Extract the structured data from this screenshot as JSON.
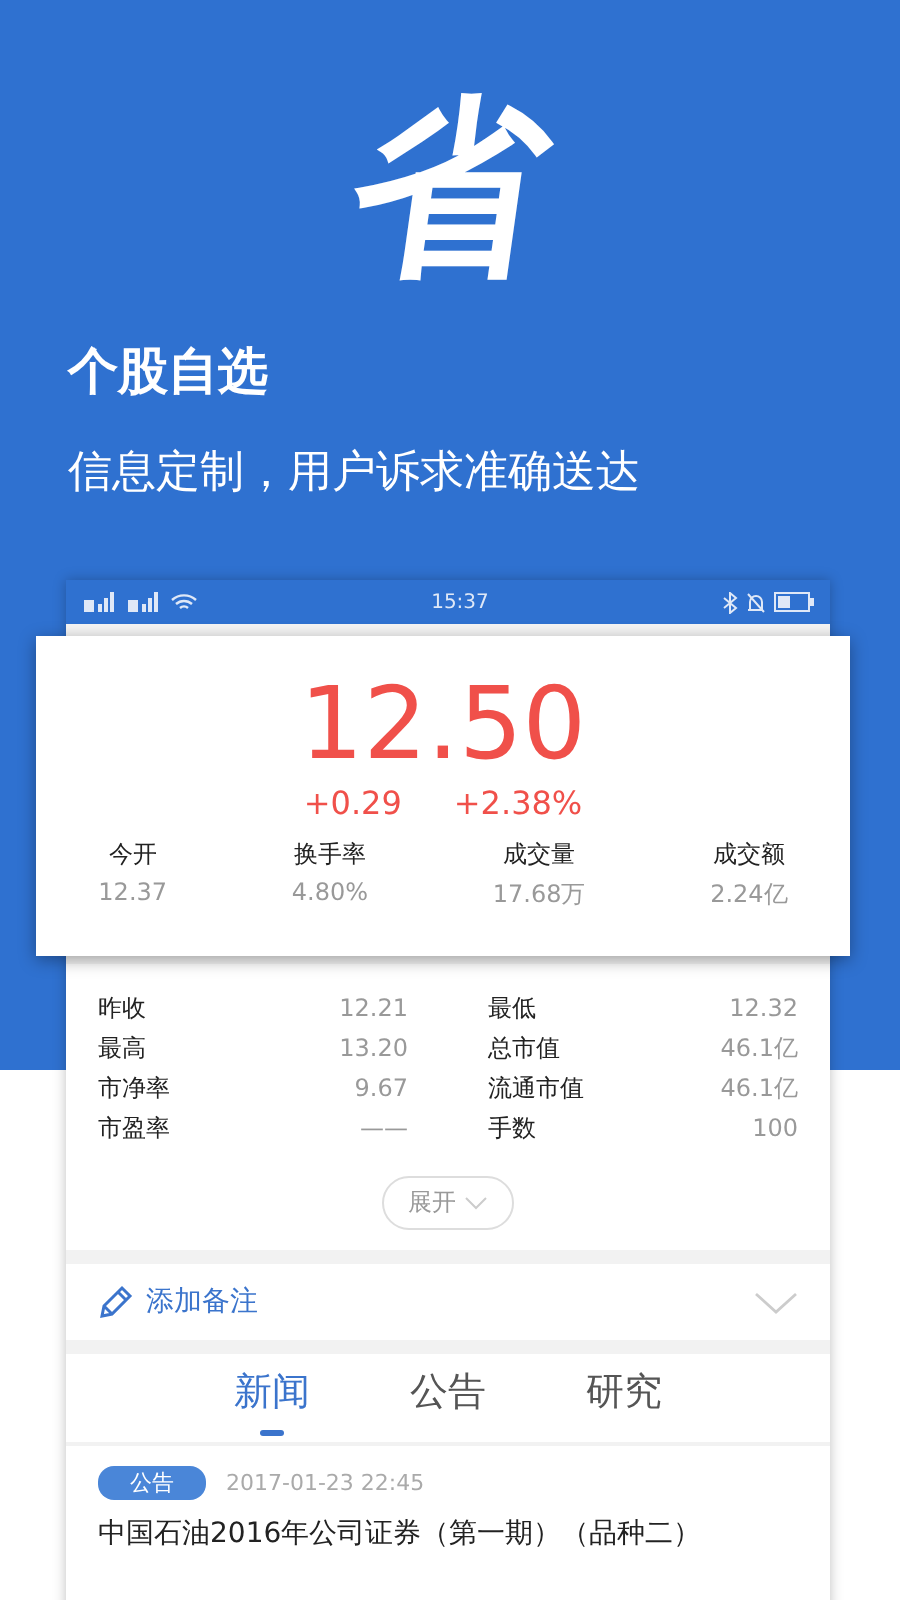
{
  "promo": {
    "glyph": "省",
    "title": "个股自选",
    "subtitle": "信息定制，用户诉求准确送达"
  },
  "status_bar": {
    "time": "15:37"
  },
  "quote": {
    "price": "12.50",
    "change": "+0.29",
    "change_pct": "+2.38%",
    "stats": [
      {
        "label": "今开",
        "value": "12.37"
      },
      {
        "label": "换手率",
        "value": "4.80%"
      },
      {
        "label": "成交量",
        "value": "17.68万"
      },
      {
        "label": "成交额",
        "value": "2.24亿"
      }
    ]
  },
  "details": [
    {
      "label": "昨收",
      "value": "12.21"
    },
    {
      "label": "最低",
      "value": "12.32"
    },
    {
      "label": "最高",
      "value": "13.20"
    },
    {
      "label": "总市值",
      "value": "46.1亿"
    },
    {
      "label": "市净率",
      "value": "9.67"
    },
    {
      "label": "流通市值",
      "value": "46.1亿"
    },
    {
      "label": "市盈率",
      "value": "——"
    },
    {
      "label": "手数",
      "value": "100"
    }
  ],
  "expand_button": "展开",
  "note": {
    "label": "添加备注"
  },
  "tabs": [
    {
      "label": "新闻",
      "selected": true
    },
    {
      "label": "公告",
      "selected": false
    },
    {
      "label": "研究",
      "selected": false
    }
  ],
  "news": [
    {
      "tag": "公告",
      "time": "2017-01-23  22:45",
      "title": "中国石油2016年公司证券（第一期）（品种二）"
    }
  ]
}
